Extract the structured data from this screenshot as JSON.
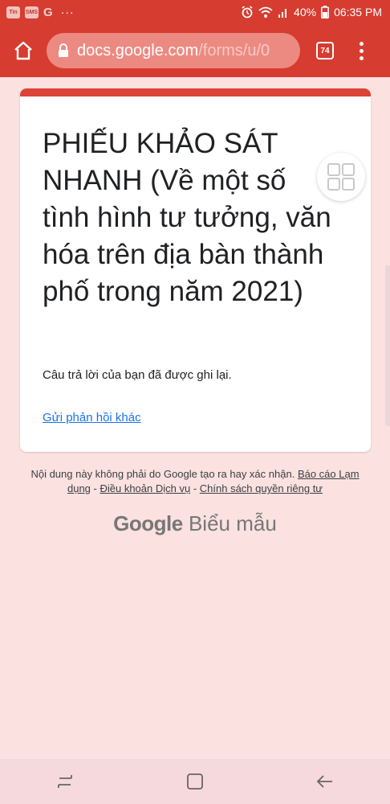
{
  "status_bar": {
    "notif_badge_1": "Tin",
    "notif_badge_2": "SMS",
    "google_glyph": "G",
    "more_dots": "···",
    "battery": "40%",
    "time": "06:35 PM",
    "icons": [
      "alarm-icon",
      "wifi-icon",
      "signal-icon",
      "battery-icon"
    ]
  },
  "browser": {
    "url_domain": "docs.google.com",
    "url_path": "/forms/u/0",
    "tab_count": "74",
    "accent": "#d63c30"
  },
  "card": {
    "title": "PHIẾU KHẢO SÁT NHANH (Về một số tình hình tư tưởng, văn hóa trên địa bàn thành phố trong năm 2021)",
    "confirmation": "Câu trả lời của bạn đã được ghi lại.",
    "submit_another": "Gửi phản hồi khác",
    "accent": "#db4437"
  },
  "footer": {
    "disclaimer": "Nội dung này không phải do Google tạo ra hay xác nhận.",
    "report_abuse": "Báo cáo Lạm dụng",
    "sep1": " - ",
    "terms": "Điều khoản Dịch vụ",
    "sep2": " - ",
    "privacy": "Chính sách quyền riêng tư",
    "logo_google": "Google",
    "logo_forms": "Biểu mẫu"
  }
}
